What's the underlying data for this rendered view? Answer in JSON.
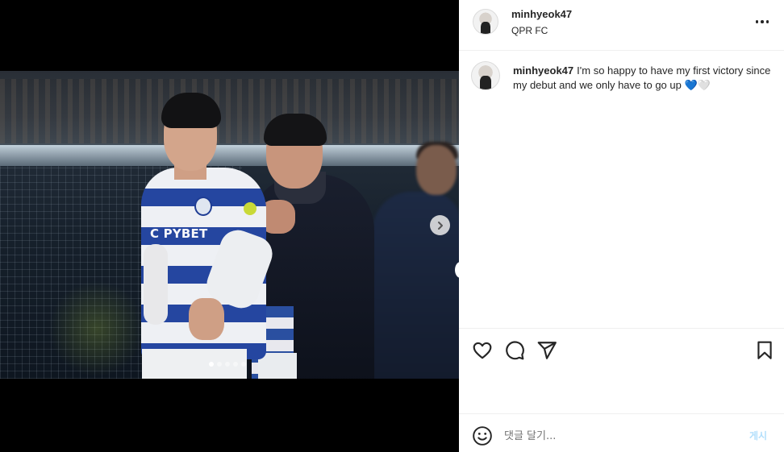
{
  "post": {
    "username": "minhyeok47",
    "location": "QPR FC",
    "caption_username": "minhyeok47",
    "caption_text": "I'm so happy to have my first victory since my debut and we only have to go up",
    "caption_emoji_1": "💙",
    "caption_emoji_2": "🤍",
    "photo_sponsor_text": "C PYBET"
  },
  "carousel": {
    "total_slides": 5,
    "current_slide": 1
  },
  "comment": {
    "placeholder": "댓글 달기...",
    "post_label": "게시"
  },
  "icons": {
    "more": "more-options-icon",
    "like": "heart-icon",
    "comment": "comment-icon",
    "share": "share-icon",
    "save": "bookmark-icon",
    "emoji": "emoji-icon",
    "next": "chevron-right-icon"
  },
  "colors": {
    "post_button_disabled": "#b2dffc",
    "kit_blue": "#2546a0"
  }
}
